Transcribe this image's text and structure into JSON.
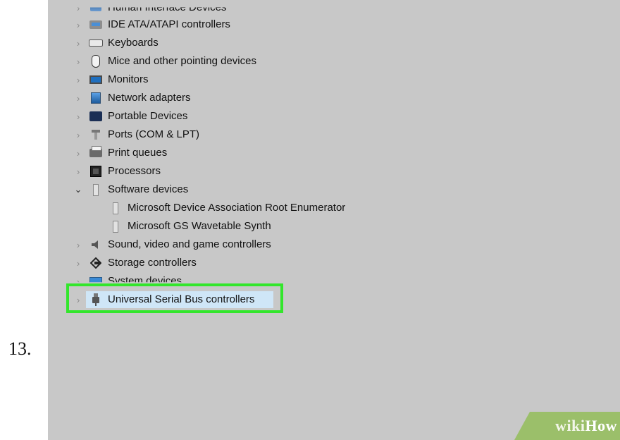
{
  "step_number": "13.",
  "device_tree": [
    {
      "label": "Human Interface Devices",
      "icon": "hid-icon",
      "expander": "collapsed"
    },
    {
      "label": "IDE ATA/ATAPI controllers",
      "icon": "ide-controller-icon",
      "expander": "collapsed"
    },
    {
      "label": "Keyboards",
      "icon": "keyboard-icon",
      "expander": "collapsed"
    },
    {
      "label": "Mice and other pointing devices",
      "icon": "mouse-icon",
      "expander": "collapsed"
    },
    {
      "label": "Monitors",
      "icon": "monitor-icon",
      "expander": "collapsed"
    },
    {
      "label": "Network adapters",
      "icon": "network-adapter-icon",
      "expander": "collapsed"
    },
    {
      "label": "Portable Devices",
      "icon": "portable-device-icon",
      "expander": "collapsed"
    },
    {
      "label": "Ports (COM & LPT)",
      "icon": "port-icon",
      "expander": "collapsed"
    },
    {
      "label": "Print queues",
      "icon": "printer-icon",
      "expander": "collapsed"
    },
    {
      "label": "Processors",
      "icon": "processor-icon",
      "expander": "collapsed"
    },
    {
      "label": "Software devices",
      "icon": "software-device-icon",
      "expander": "expanded"
    },
    {
      "label": "Microsoft Device Association Root Enumerator",
      "icon": "software-device-icon",
      "child": true
    },
    {
      "label": "Microsoft GS Wavetable Synth",
      "icon": "software-device-icon",
      "child": true
    },
    {
      "label": "Sound, video and game controllers",
      "icon": "speaker-icon",
      "expander": "collapsed"
    },
    {
      "label": "Storage controllers",
      "icon": "storage-controller-icon",
      "expander": "collapsed"
    },
    {
      "label": "System devices",
      "icon": "system-device-icon",
      "expander": "collapsed"
    },
    {
      "label": "Universal Serial Bus controllers",
      "icon": "usb-icon",
      "expander": "collapsed",
      "selected": true
    }
  ],
  "watermark": {
    "wiki": "wiki",
    "how": "How"
  },
  "colors": {
    "highlight_border": "#33e62c",
    "screen_bg": "#c8c8c8",
    "badge": "#9bbf6a"
  }
}
